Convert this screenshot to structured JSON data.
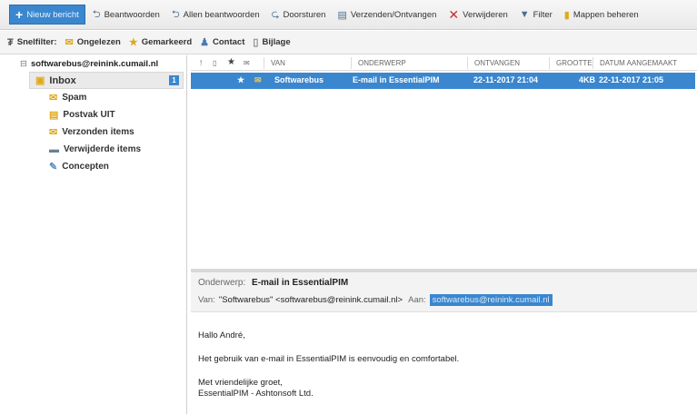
{
  "toolbar": {
    "new_mail": "Nieuw bericht",
    "reply": "Beantwoorden",
    "reply_all": "Allen beantwoorden",
    "forward": "Doorsturen",
    "send_receive": "Verzenden/Ontvangen",
    "delete": "Verwijderen",
    "filter": "Filter",
    "manage_folders": "Mappen beheren"
  },
  "quickfilter": {
    "label": "Snelfilter:",
    "unread": "Ongelezen",
    "marked": "Gemarkeerd",
    "contact": "Contact",
    "attachment": "Bijlage"
  },
  "folders": {
    "account": "softwarebus@reinink.cumail.nl",
    "inbox": "Inbox",
    "inbox_badge": "1",
    "items": [
      "Spam",
      "Postvak UIT",
      "Verzonden items",
      "Verwijderde items",
      "Concepten"
    ]
  },
  "columns": {
    "from": "VAN",
    "subject": "ONDERWERP",
    "received": "ONTVANGEN",
    "size": "GROOTTE",
    "created": "DATUM AANGEMAAKT"
  },
  "messages": [
    {
      "from": "Softwarebus",
      "subject": "E-mail in EssentialPIM",
      "received": "22-11-2017 21:04",
      "size": "4KB",
      "created": "22-11-2017 21:05"
    }
  ],
  "preview": {
    "subject_label": "Onderwerp:",
    "subject": "E-mail in EssentialPIM",
    "from_label": "Van:",
    "from": "\"Softwarebus\" <softwarebus@reinink.cumail.nl>",
    "to_label": "Aan:",
    "to": "softwarebus@reinink.cumail.nl",
    "greeting": "Hallo André,",
    "body": "Het gebruik van e-mail in EssentialPIM is eenvoudig en comfortabel.",
    "closing": "Met vriendelijke groet,",
    "signature": "EssentialPIM - Ashtonsoft Ltd."
  },
  "colors": {
    "accent": "#3a87cf"
  }
}
